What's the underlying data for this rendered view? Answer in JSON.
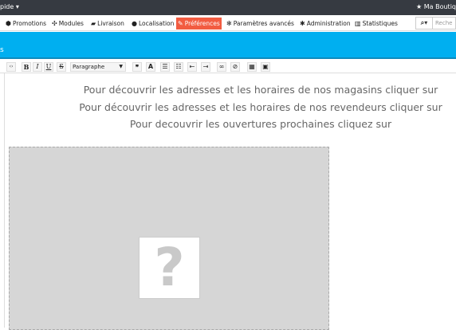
{
  "topbar": {
    "left_label": "pide",
    "right_label": "Ma Boutiq"
  },
  "menu": {
    "items": [
      {
        "label": "Promotions",
        "icon": "tags-icon"
      },
      {
        "label": "Modules",
        "icon": "puzzle-icon"
      },
      {
        "label": "Livraison",
        "icon": "truck-icon"
      },
      {
        "label": "Localisation",
        "icon": "globe-icon"
      },
      {
        "label": "Préférences",
        "icon": "wrench-icon"
      },
      {
        "label": "Paramètres avancés",
        "icon": "cogs-icon"
      },
      {
        "label": "Administration",
        "icon": "gear-icon"
      },
      {
        "label": "Statistiques",
        "icon": "bar-chart-icon"
      }
    ],
    "active": "Préférences"
  },
  "search": {
    "placeholder": "Reche"
  },
  "bluebar": {
    "edge_text": "s"
  },
  "toolbar": {
    "format_select": "Paragraphe"
  },
  "content": {
    "line1": "Pour découvrir les adresses et les horaires de nos magasins cliquer sur",
    "line2": "Pour découvrir les adresses et les horaires de nos revendeurs cliquer sur",
    "line3": "Pour decouvrir les ouvertures prochaines cliquez sur",
    "placeholder_glyph": "?"
  },
  "colors": {
    "accent": "#f25c41",
    "header_blue": "#00aff0",
    "topbar": "#363a41"
  }
}
